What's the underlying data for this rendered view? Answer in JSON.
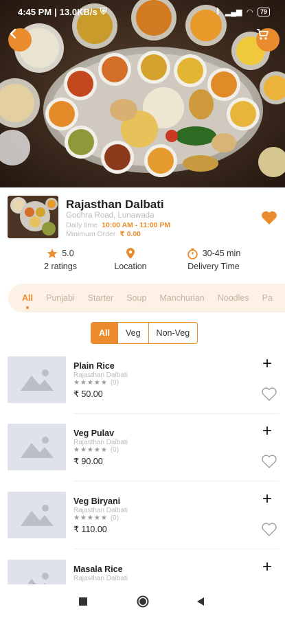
{
  "status": {
    "time": "4:45 PM",
    "speed": "13.0KB/s",
    "battery": "79"
  },
  "header": {
    "back_icon": "chevron-left-icon",
    "cart_icon": "cart-icon"
  },
  "restaurant": {
    "name": "Rajasthan Dalbati",
    "address": "Godhra Road, Lunawada",
    "daily_time_label": "Daily time",
    "daily_time_value": "10:00 AM - 11:00 PM",
    "min_order_label": "Minimum Order",
    "min_order_value": "₹ 0.00"
  },
  "stats": {
    "rating_value": "5.0",
    "rating_label": "2 ratings",
    "location_label": "Location",
    "delivery_value": "30-45 min",
    "delivery_label": "Delivery Time"
  },
  "categories": [
    "All",
    "Punjabi",
    "Starter",
    "Soup",
    "Manchurian",
    "Noodles",
    "Pa"
  ],
  "filters": [
    "All",
    "Veg",
    "Non-Veg"
  ],
  "items": [
    {
      "name": "Plain Rice",
      "restaurant": "Rajasthan Dalbati",
      "stars": "★★★★★",
      "count": "(0)",
      "price": "₹ 50.00"
    },
    {
      "name": "Veg Pulav",
      "restaurant": "Rajasthan Dalbati",
      "stars": "★★★★★",
      "count": "(0)",
      "price": "₹ 90.00"
    },
    {
      "name": "Veg Biryani",
      "restaurant": "Rajasthan Dalbati",
      "stars": "★★★★★",
      "count": "(0)",
      "price": "₹ 110.00"
    },
    {
      "name": "Masala Rice",
      "restaurant": "Rajasthan Dalbati",
      "stars": "",
      "count": "",
      "price": ""
    }
  ],
  "colors": {
    "accent": "#ea8b2d",
    "category_bg": "#fdf1e6",
    "placeholder": "#dfe2ea"
  }
}
